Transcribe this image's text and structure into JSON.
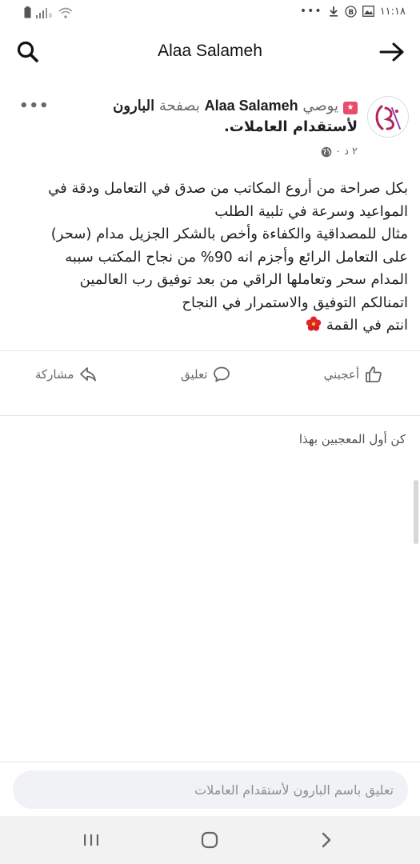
{
  "status_bar": {
    "time": "١١:١٨",
    "dots": "•••"
  },
  "header": {
    "title": "Alaa Salameh"
  },
  "post": {
    "line1_strong_page": "البارون",
    "line1_muted_via": "بصفحة",
    "line1_strong_name": "Alaa Salameh",
    "line1_muted_label": "يوصي",
    "line2": "لأستقدام العاملات.",
    "time": "٢ د ٠",
    "more": "•••",
    "body_lines": [
      "بكل صراحة من أروع المكاتب من صدق في التعامل ودقة في",
      "المواعيد وسرعة في تلبية الطلب",
      "مثال للمصداقية والكفاءة وأخص بالشكر الجزيل مدام (سحر)",
      "على التعامل الرائع وأجزم انه 90% من نجاح المكتب سببه",
      "المدام سحر وتعاملها الراقي من بعد توفيق رب العالمين",
      "اتمنالكم التوفيق والاستمرار في النجاح",
      "انتم في القمة"
    ]
  },
  "actions": {
    "like": "أعجبني",
    "comment": "تعليق",
    "share": "مشاركة"
  },
  "likes_text": "كن أول المعجبين بهذا",
  "comment_input": {
    "placeholder": "تعليق باسم البارون لأستقدام العاملات"
  },
  "colors": {
    "accent_badge": "#e74c6b",
    "muted": "#65676b",
    "input_bg": "#f0f2f5"
  },
  "icons": {
    "search": "search-icon",
    "back": "arrow-right-icon",
    "like": "thumbs-up-icon",
    "comment": "speech-bubble-icon",
    "share": "share-arrow-icon",
    "globe": "globe-icon",
    "flower": "hibiscus-icon"
  }
}
